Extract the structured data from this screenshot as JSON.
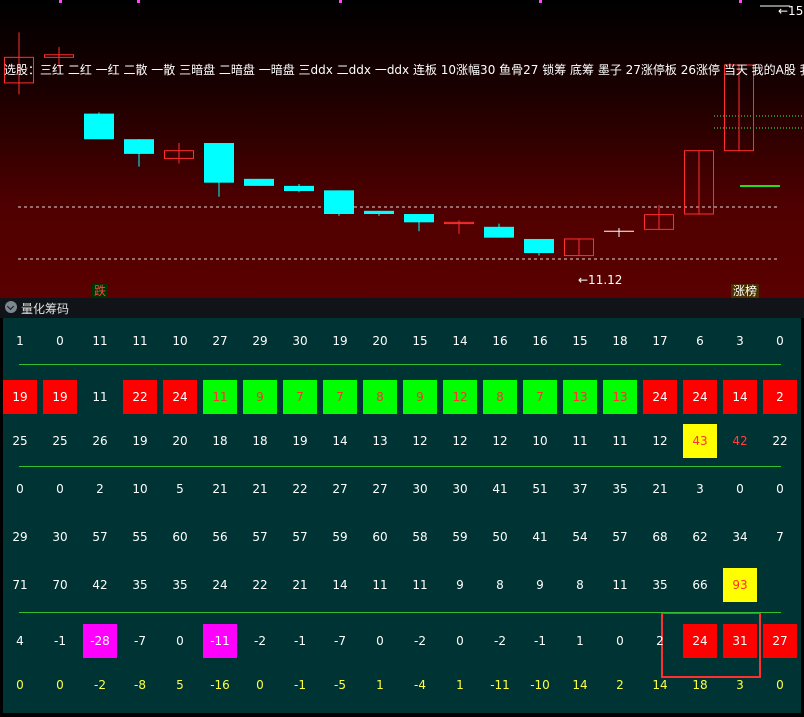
{
  "chart": {
    "selector_text": "选股：三红 二红 一红 二散 一散 三暗盘 二暗盘 一暗盘 三ddx 二ddx 一ddx 连板 10涨幅30 鱼骨27 锁筹 底筹 墨子 27涨停板 26涨停 当天 我的A股 我",
    "low_price_label": "←11.12",
    "top_price_label": "←15",
    "down_tag": "跌",
    "up_tag": "涨榜",
    "colors": {
      "up": "#ff3030",
      "down": "#00ffff",
      "neutral": "#ffffff"
    },
    "candles": [
      {
        "type": "up",
        "open": 14.16,
        "close": 14.56,
        "high": 14.95,
        "low": 13.98
      },
      {
        "type": "up",
        "open": 14.56,
        "close": 14.6,
        "high": 14.72,
        "low": 14.4
      },
      {
        "type": "down",
        "open": 13.68,
        "close": 13.28,
        "high": 13.7,
        "low": 13.28
      },
      {
        "type": "down",
        "open": 13.28,
        "close": 13.05,
        "high": 13.28,
        "low": 12.85
      },
      {
        "type": "up",
        "open": 12.98,
        "close": 13.1,
        "high": 13.22,
        "low": 12.9
      },
      {
        "type": "down",
        "open": 13.22,
        "close": 12.6,
        "high": 13.22,
        "low": 12.38
      },
      {
        "type": "down",
        "open": 12.66,
        "close": 12.55,
        "high": 12.66,
        "low": 12.55
      },
      {
        "type": "down",
        "open": 12.55,
        "close": 12.47,
        "high": 12.58,
        "low": 12.45
      },
      {
        "type": "down",
        "open": 12.48,
        "close": 12.11,
        "high": 12.48,
        "low": 12.08
      },
      {
        "type": "down",
        "open": 12.16,
        "close": 12.11,
        "high": 12.16,
        "low": 12.08
      },
      {
        "type": "down",
        "open": 12.11,
        "close": 11.98,
        "high": 12.11,
        "low": 11.84
      },
      {
        "type": "up",
        "open": 11.96,
        "close": 11.98,
        "high": 12.01,
        "low": 11.8
      },
      {
        "type": "down",
        "open": 11.91,
        "close": 11.74,
        "high": 11.96,
        "low": 11.74
      },
      {
        "type": "down",
        "open": 11.72,
        "close": 11.5,
        "high": 11.72,
        "low": 11.46
      },
      {
        "type": "up",
        "open": 11.46,
        "close": 11.72,
        "high": 11.72,
        "low": 11.46
      },
      {
        "type": "neutral",
        "open": 11.82,
        "close": 11.84,
        "high": 11.89,
        "low": 11.75
      },
      {
        "type": "up",
        "open": 11.87,
        "close": 12.1,
        "high": 12.25,
        "low": 11.87
      },
      {
        "type": "up",
        "open": 12.11,
        "close": 13.1,
        "high": 13.1,
        "low": 12.11
      },
      {
        "type": "up",
        "open": 13.1,
        "close": 14.44,
        "high": 14.44,
        "low": 13.1
      }
    ]
  },
  "panel": {
    "title": "量化筹码"
  },
  "grid": {
    "rows": [
      {
        "values": [
          "1",
          "0",
          "11",
          "11",
          "10",
          "27",
          "29",
          "30",
          "19",
          "20",
          "15",
          "14",
          "16",
          "16",
          "15",
          "18",
          "17",
          "6",
          "3",
          "0"
        ],
        "text": "#ffffff",
        "bg": []
      },
      {
        "values": [
          "19",
          "19",
          "11",
          "22",
          "24",
          "11",
          "9",
          "7",
          "7",
          "8",
          "9",
          "12",
          "8",
          "7",
          "13",
          "13",
          "24",
          "24",
          "14",
          "2"
        ],
        "text": "#ffffff",
        "bg": [
          "red",
          "red",
          "",
          "red",
          "red",
          "green",
          "green",
          "green",
          "green",
          "green",
          "green",
          "green",
          "green",
          "green",
          "green",
          "green",
          "red",
          "red",
          "red",
          "red"
        ]
      },
      {
        "values": [
          "25",
          "25",
          "26",
          "19",
          "20",
          "18",
          "18",
          "19",
          "14",
          "13",
          "12",
          "12",
          "12",
          "10",
          "11",
          "11",
          "12",
          "43",
          "42",
          "22"
        ],
        "text": "#ffffff",
        "bg": [
          "",
          "",
          "",
          "",
          "",
          "",
          "",
          "",
          "",
          "",
          "",
          "",
          "",
          "",
          "",
          "",
          "",
          "yellow",
          "",
          ""
        ]
      },
      {
        "values": [
          "0",
          "0",
          "2",
          "10",
          "5",
          "21",
          "21",
          "22",
          "27",
          "27",
          "30",
          "30",
          "41",
          "51",
          "37",
          "35",
          "21",
          "3",
          "0",
          "0"
        ],
        "text": "#ffffff",
        "bg": []
      },
      {
        "values": [
          "29",
          "30",
          "57",
          "55",
          "60",
          "56",
          "57",
          "57",
          "59",
          "60",
          "58",
          "59",
          "50",
          "41",
          "54",
          "57",
          "68",
          "62",
          "34",
          "7"
        ],
        "text": "#ffffff",
        "bg": []
      },
      {
        "values": [
          "71",
          "70",
          "42",
          "35",
          "35",
          "24",
          "22",
          "21",
          "14",
          "11",
          "11",
          "9",
          "8",
          "9",
          "8",
          "11",
          "35",
          "66",
          "93"
        ],
        "text": "#ffffff",
        "bg": [
          "",
          "",
          "",
          "",
          "",
          "",
          "",
          "",
          "",
          "",
          "",
          "",
          "",
          "",
          "",
          "",
          "",
          "",
          "yellow"
        ]
      },
      {
        "values": [
          "4",
          "-1",
          "-28",
          "-7",
          "0",
          "-11",
          "-2",
          "-1",
          "-7",
          "0",
          "-2",
          "0",
          "-2",
          "-1",
          "1",
          "0",
          "2",
          "24",
          "31",
          "27"
        ],
        "text": "#ffffff",
        "bg": [
          "",
          "",
          "magenta",
          "",
          "",
          "magenta",
          "",
          "",
          "",
          "",
          "",
          "",
          "",
          "",
          "",
          "",
          "",
          "red",
          "red",
          "red"
        ]
      },
      {
        "values": [
          "0",
          "0",
          "-2",
          "-8",
          "5",
          "-16",
          "0",
          "-1",
          "-5",
          "1",
          "-4",
          "1",
          "-11",
          "-10",
          "14",
          "2",
          "14",
          "18",
          "3",
          "0"
        ],
        "text": "#ffff44",
        "bg": []
      }
    ]
  }
}
